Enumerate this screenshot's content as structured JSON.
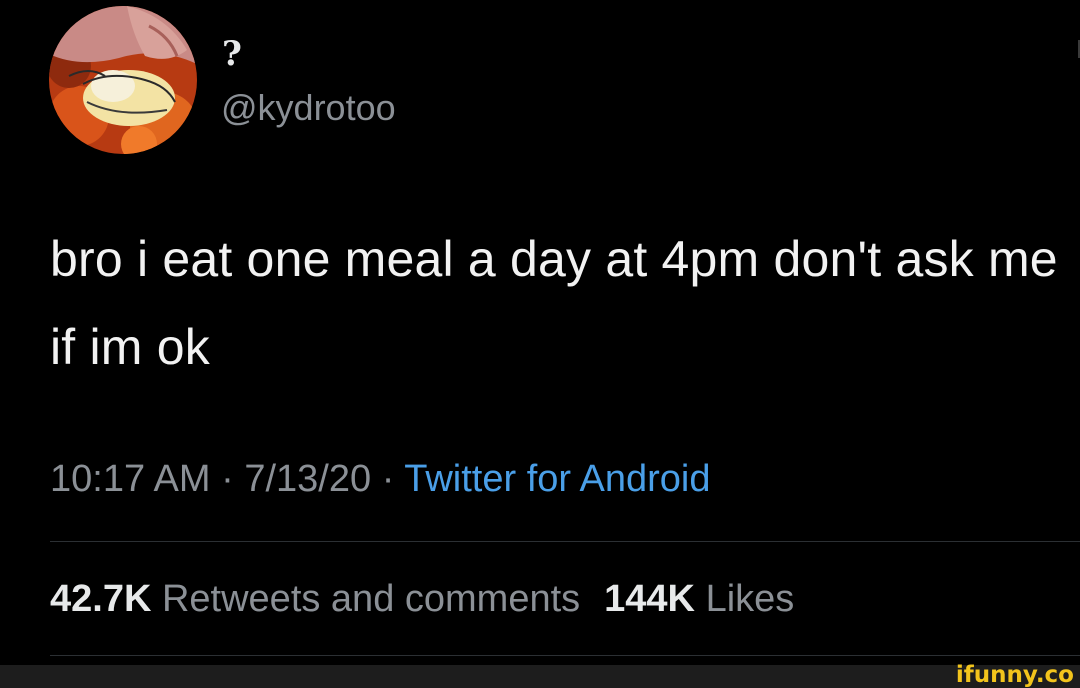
{
  "tweet": {
    "display_name": "?",
    "handle": "@kydrotoo",
    "text": "bro i eat one meal a day at 4pm don't ask me if im ok",
    "time": "10:17 AM",
    "separator": " · ",
    "date": "7/13/20",
    "client": "Twitter for Android",
    "retweets_count": "42.7K",
    "retweets_label": "Retweets and comments",
    "likes_count": "144K",
    "likes_label": "Likes"
  },
  "watermark": "ifunny.co",
  "colors": {
    "background": "#000000",
    "text": "#e7e9ea",
    "muted": "#8b9096",
    "link": "#4a9fe8",
    "divider": "#2b2f33",
    "watermark": "#f2c41c"
  },
  "icons": {
    "avatar": "anime-character-avatar"
  }
}
